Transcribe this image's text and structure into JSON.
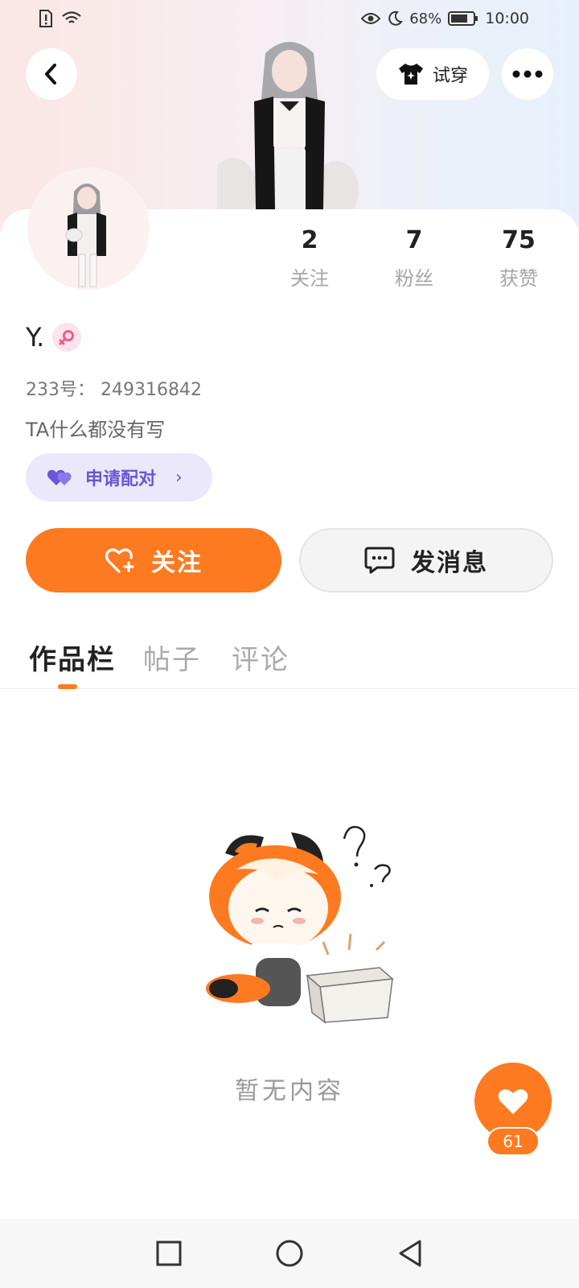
{
  "status_bar": {
    "battery": "68%",
    "time": "10:00"
  },
  "header": {
    "try_on_label": "试穿"
  },
  "profile": {
    "stats": [
      {
        "value": "2",
        "label": "关注"
      },
      {
        "value": "7",
        "label": "粉丝"
      },
      {
        "value": "75",
        "label": "获赞"
      }
    ],
    "username": "Y.",
    "gender": "female",
    "uid": "233号：  249316842",
    "bio": "TA什么都没有写",
    "pair_label": "申请配对",
    "follow_label": "关注",
    "message_label": "发消息"
  },
  "tabs": [
    {
      "label": "作品栏",
      "active": true
    },
    {
      "label": "帖子",
      "active": false
    },
    {
      "label": "评论",
      "active": false
    }
  ],
  "empty_state": {
    "text": "暂无内容"
  },
  "like_fab": {
    "count": "61"
  },
  "colors": {
    "accent": "#fe7a20",
    "pair_accent": "#6a55d8"
  }
}
